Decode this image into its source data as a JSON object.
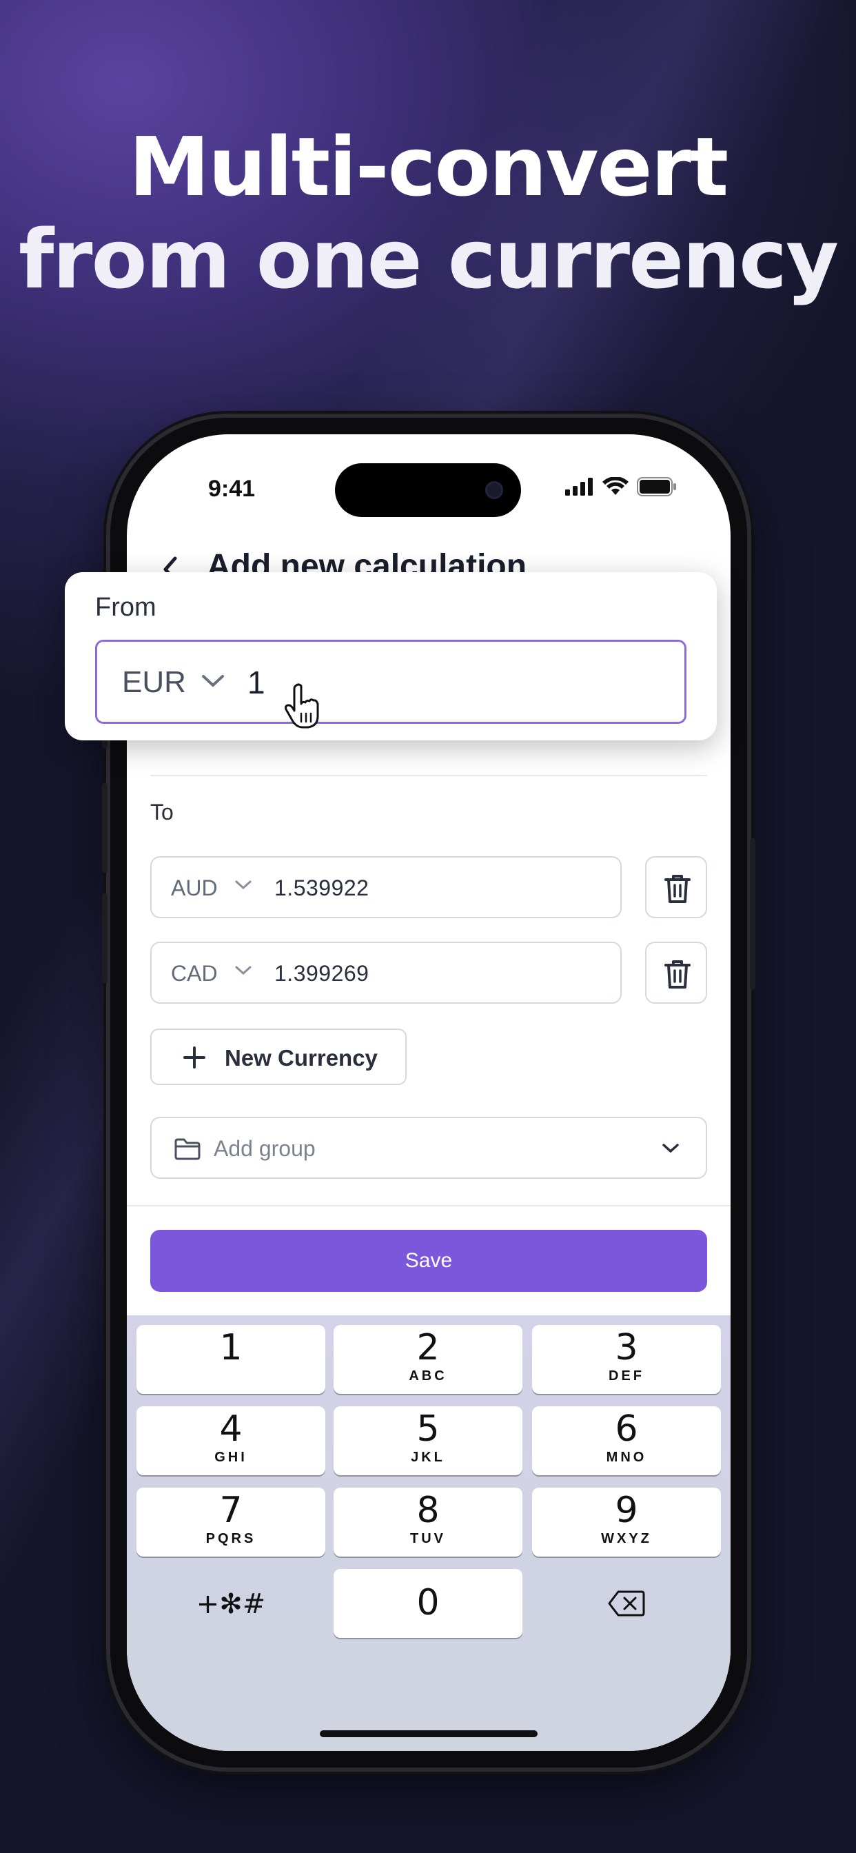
{
  "headline": {
    "line1": "Multi-convert",
    "line2": "from one currency"
  },
  "status": {
    "time": "9:41"
  },
  "nav": {
    "title": "Add new calculation"
  },
  "from": {
    "label": "From",
    "currency": "EUR",
    "value": "1"
  },
  "to": {
    "label": "To",
    "rows": [
      {
        "currency": "AUD",
        "value": "1.539922"
      },
      {
        "currency": "CAD",
        "value": "1.399269"
      }
    ]
  },
  "actions": {
    "new_currency": "New Currency",
    "add_group": "Add group",
    "save": "Save"
  },
  "keyboard": {
    "keys": [
      {
        "num": "1",
        "sub": ""
      },
      {
        "num": "2",
        "sub": "ABC"
      },
      {
        "num": "3",
        "sub": "DEF"
      },
      {
        "num": "4",
        "sub": "GHI"
      },
      {
        "num": "5",
        "sub": "JKL"
      },
      {
        "num": "6",
        "sub": "MNO"
      },
      {
        "num": "7",
        "sub": "PQRS"
      },
      {
        "num": "8",
        "sub": "TUV"
      },
      {
        "num": "9",
        "sub": "WXYZ"
      }
    ],
    "symbols": "+✻#",
    "zero": "0"
  },
  "colors": {
    "accent": "#7b57db",
    "focus_border": "#8b6bd8"
  },
  "icons": [
    "back-chevron-icon",
    "chevron-down-icon",
    "trash-icon",
    "plus-icon",
    "folder-icon",
    "delete-key-icon",
    "hand-cursor-icon",
    "signal-icon",
    "wifi-icon",
    "battery-icon"
  ]
}
